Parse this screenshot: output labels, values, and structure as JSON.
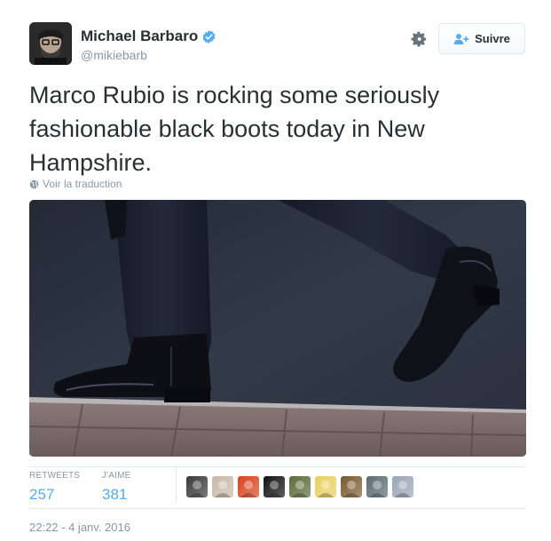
{
  "author": {
    "name": "Michael Barbaro",
    "handle": "@mikiebarb",
    "verified": true
  },
  "follow_button": {
    "label": "Suivre"
  },
  "tweet": {
    "text": "Marco Rubio is rocking some seriously fashionable black boots today in New Hampshire.",
    "translate_label": "Voir la traduction"
  },
  "stats": {
    "retweets_label": "RETWEETS",
    "retweets_value": "257",
    "likes_label": "J'AIME",
    "likes_value": "381"
  },
  "likers": [
    {
      "color": "#3a3a3a"
    },
    {
      "color": "#c9b9a8"
    },
    {
      "color": "#d9431e"
    },
    {
      "color": "#111111"
    },
    {
      "color": "#5a6b3a"
    },
    {
      "color": "#e8d060"
    },
    {
      "color": "#7a5a30"
    },
    {
      "color": "#5b6b73"
    },
    {
      "color": "#9aa5b5"
    }
  ],
  "timestamp": "22:22 - 4 janv. 2016",
  "colors": {
    "accent": "#55acee",
    "verified": "#55acee",
    "muted": "#8899a6"
  }
}
